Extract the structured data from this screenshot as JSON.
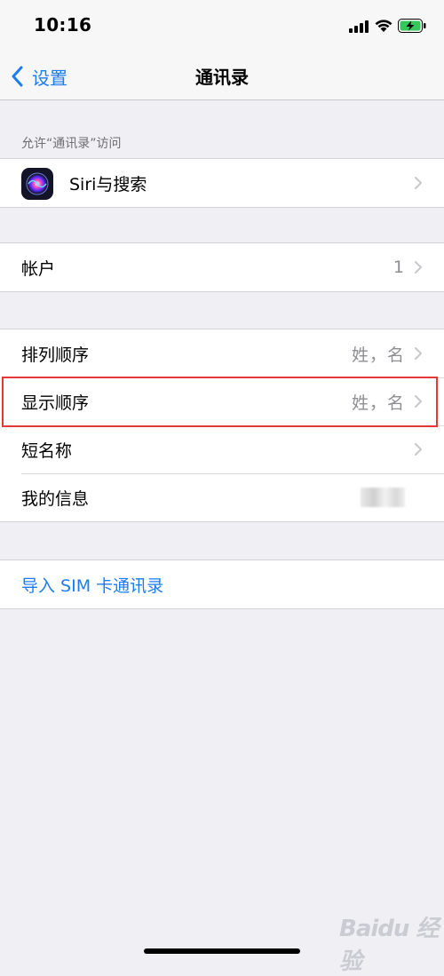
{
  "status_bar": {
    "time": "10:16"
  },
  "nav": {
    "back_label": "设置",
    "title": "通讯录"
  },
  "section_header": "允许“通讯录”访问",
  "siri_row": {
    "label": "Siri与搜索"
  },
  "accounts_row": {
    "label": "帐户",
    "value": "1"
  },
  "settings_rows": [
    {
      "label": "排列顺序",
      "value": "姓，名"
    },
    {
      "label": "显示顺序",
      "value": "姓，名"
    },
    {
      "label": "短名称"
    },
    {
      "label": "我的信息"
    }
  ],
  "import_row": {
    "label": "导入 SIM 卡通讯录"
  },
  "watermark": "Baidu 经验",
  "colors": {
    "accent": "#1d7cf2",
    "highlight_border": "#e53935",
    "battery": "#34c759"
  }
}
